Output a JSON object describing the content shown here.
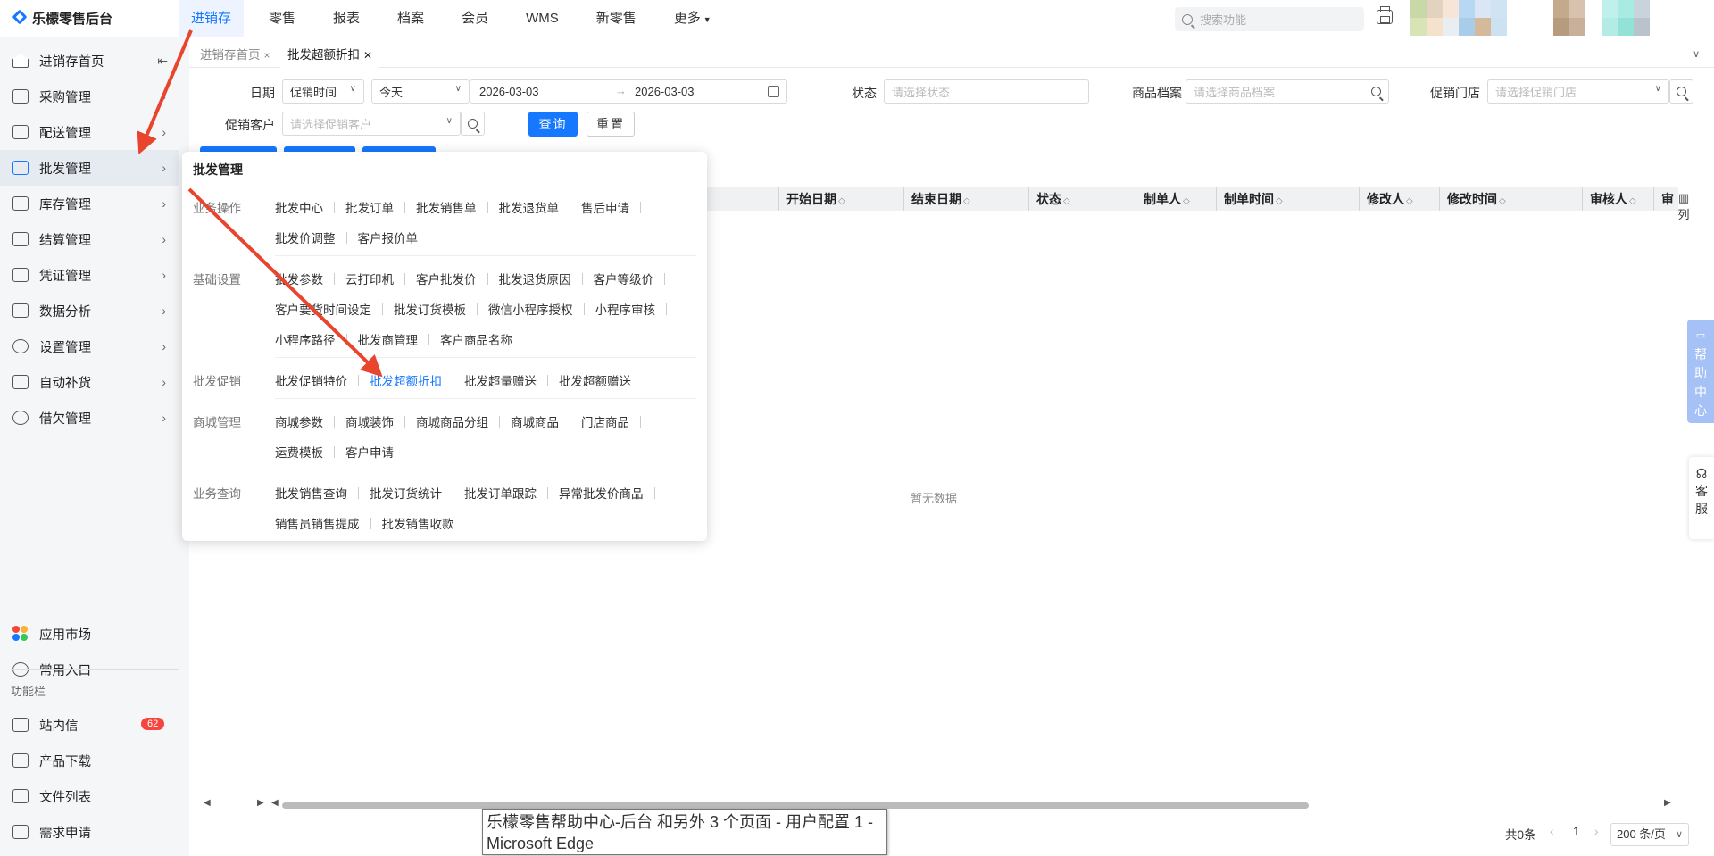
{
  "app": {
    "title": "乐檬零售后台"
  },
  "topnav": [
    {
      "label": "进销存",
      "active": true
    },
    {
      "label": "零售"
    },
    {
      "label": "报表"
    },
    {
      "label": "档案"
    },
    {
      "label": "会员"
    },
    {
      "label": "WMS"
    },
    {
      "label": "新零售"
    },
    {
      "label": "更多"
    }
  ],
  "top_search": {
    "placeholder": "搜索功能"
  },
  "sidebar": {
    "items": [
      {
        "label": "进销存首页",
        "icon": "home-icon"
      },
      {
        "label": "采购管理",
        "icon": "cart-icon"
      },
      {
        "label": "配送管理",
        "icon": "box-icon"
      },
      {
        "label": "批发管理",
        "icon": "wallet-icon",
        "active": true
      },
      {
        "label": "库存管理",
        "icon": "warehouse-icon"
      },
      {
        "label": "结算管理",
        "icon": "dollar-icon"
      },
      {
        "label": "凭证管理",
        "icon": "document-icon"
      },
      {
        "label": "数据分析",
        "icon": "chart-icon"
      },
      {
        "label": "设置管理",
        "icon": "settings-icon"
      },
      {
        "label": "自动补货",
        "icon": "robot-icon"
      },
      {
        "label": "借欠管理",
        "icon": "database-icon"
      }
    ],
    "bottom_items": [
      {
        "label": "应用市场",
        "icon": "app-market-icon"
      },
      {
        "label": "常用入口",
        "icon": "heart-icon"
      }
    ],
    "section_caption": "功能栏",
    "tool_items": [
      {
        "label": "站内信",
        "icon": "mail-icon",
        "badge": "62"
      },
      {
        "label": "产品下载",
        "icon": "download-icon"
      },
      {
        "label": "文件列表",
        "icon": "file-list-icon"
      },
      {
        "label": "需求申请",
        "icon": "request-icon"
      }
    ]
  },
  "tabs": [
    {
      "label": "进销存首页",
      "close": "×"
    },
    {
      "label": "批发超额折扣",
      "close": "✕",
      "active": true
    }
  ],
  "filters": {
    "date_label": "日期",
    "date_type": "促销时间",
    "date_range_preset": "今天",
    "date_start": "2026-03-03",
    "date_sep": "→",
    "date_end": "2026-03-03",
    "status_label": "状态",
    "status_placeholder": "请选择状态",
    "product_label": "商品档案",
    "product_placeholder": "请选择商品档案",
    "store_label": "促销门店",
    "store_placeholder": "请选择促销门店",
    "customer_label": "促销客户",
    "customer_placeholder": "请选择促销客户",
    "query_button": "查询",
    "reset_button": "重置"
  },
  "table": {
    "columns": [
      "开始日期",
      "结束日期",
      "状态",
      "制单人",
      "制单时间",
      "修改人",
      "修改时间",
      "审核人",
      "审"
    ],
    "empty_text": "暂无数据",
    "column_setting": "列"
  },
  "popover": {
    "title": "批发管理",
    "groups": [
      {
        "label": "业务操作",
        "rows": [
          [
            "批发中心",
            "批发订单",
            "批发销售单",
            "批发退货单",
            "售后申请"
          ],
          [
            "批发价调整",
            "客户报价单"
          ]
        ]
      },
      {
        "label": "基础设置",
        "rows": [
          [
            "批发参数",
            "云打印机",
            "客户批发价",
            "批发退货原因",
            "客户等级价"
          ],
          [
            "客户要货时间设定",
            "批发订货模板",
            "微信小程序授权",
            "小程序审核"
          ],
          [
            "小程序路径",
            "批发商管理",
            "客户商品名称"
          ]
        ]
      },
      {
        "label": "批发促销",
        "rows": [
          [
            "批发促销特价",
            "批发超额折扣",
            "批发超量赠送",
            "批发超额赠送"
          ]
        ],
        "current": "批发超额折扣"
      },
      {
        "label": "商城管理",
        "rows": [
          [
            "商城参数",
            "商城装饰",
            "商城商品分组",
            "商城商品",
            "门店商品"
          ],
          [
            "运费模板",
            "客户申请"
          ]
        ]
      },
      {
        "label": "业务查询",
        "rows": [
          [
            "批发销售查询",
            "批发订货统计",
            "批发订单跟踪",
            "异常批发价商品"
          ],
          [
            "销售员销售提成",
            "批发销售收款"
          ]
        ]
      }
    ]
  },
  "right_float": {
    "help": "帮助中心",
    "service": "客服"
  },
  "pagination": {
    "total": "共0条",
    "page": "1",
    "page_size": "200 条/页"
  },
  "tooltip": {
    "text": "乐檬零售帮助中心-后台 和另外 3 个页面 - 用户配置 1 - Microsoft Edge"
  },
  "colors": {
    "accent": "#1677ff",
    "annotation_arrow": "#e8442e",
    "badge": "#f5453d"
  }
}
